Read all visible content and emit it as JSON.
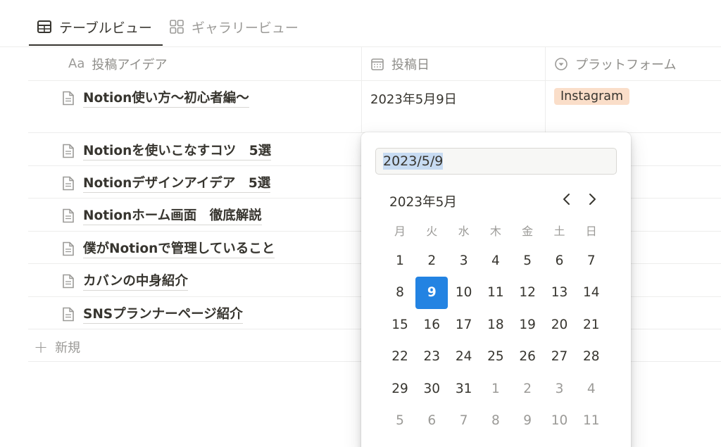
{
  "tabs": [
    {
      "label": "テーブルビュー",
      "icon": "table-icon",
      "active": true
    },
    {
      "label": "ギャラリービュー",
      "icon": "gallery-icon",
      "active": false
    }
  ],
  "columns": {
    "title": {
      "label": "投稿アイデア",
      "icon": "Aa"
    },
    "date": {
      "label": "投稿日",
      "icon": "calendar-icon"
    },
    "platform": {
      "label": "プラットフォーム",
      "icon": "select-icon"
    }
  },
  "rows": [
    {
      "title": "Notion使い方〜初心者編〜",
      "date": "2023年5月9日",
      "platform": "Instagram"
    },
    {
      "title": "Notionを使いこなすコツ　5選"
    },
    {
      "title": "Notionデザインアイデア　5選"
    },
    {
      "title": "Notionホーム画面　徹底解説"
    },
    {
      "title": "僕がNotionで管理していること"
    },
    {
      "title": "カバンの中身紹介"
    },
    {
      "title": "SNSプランナーページ紹介"
    }
  ],
  "new_row_label": "新規",
  "picker": {
    "input_value": "2023/5/9",
    "month_label": "2023年5月",
    "weekdays": [
      "月",
      "火",
      "水",
      "木",
      "金",
      "土",
      "日"
    ],
    "weeks": [
      [
        "1",
        "2",
        "3",
        "4",
        "5",
        "6",
        "7"
      ],
      [
        "8",
        "9",
        "10",
        "11",
        "12",
        "13",
        "14"
      ],
      [
        "15",
        "16",
        "17",
        "18",
        "19",
        "20",
        "21"
      ],
      [
        "22",
        "23",
        "24",
        "25",
        "26",
        "27",
        "28"
      ],
      [
        "29",
        "30",
        "31",
        "1",
        "2",
        "3",
        "4"
      ],
      [
        "5",
        "6",
        "7",
        "8",
        "9",
        "10",
        "11"
      ]
    ],
    "selected_day": "9",
    "accent_color": "#2383e2",
    "tag_color": "#fadec9"
  }
}
